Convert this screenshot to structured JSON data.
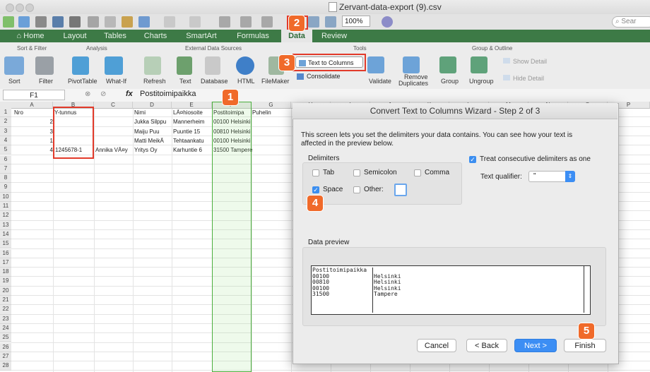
{
  "window": {
    "title": "Zervant-data-export (9).csv"
  },
  "toolbar": {
    "zoom": "100%",
    "search_placeholder": "Sear"
  },
  "tabs": [
    "Home",
    "Layout",
    "Tables",
    "Charts",
    "SmartArt",
    "Formulas",
    "Data",
    "Review"
  ],
  "ribbon": {
    "groups": [
      "Sort & Filter",
      "Analysis",
      "External Data Sources",
      "Tools",
      "Group & Outline"
    ],
    "items": {
      "sort": "Sort",
      "filter": "Filter",
      "pivottable": "PivotTable",
      "whatif": "What-If",
      "refresh": "Refresh",
      "text": "Text",
      "database": "Database",
      "html": "HTML",
      "filemaker": "FileMaker",
      "text_to_columns": "Text to Columns",
      "consolidate": "Consolidate",
      "validate": "Validate",
      "remove_dup_1": "Remove",
      "remove_dup_2": "Duplicates",
      "group": "Group",
      "ungroup": "Ungroup",
      "show_detail": "Show Detail",
      "hide_detail": "Hide Detail"
    }
  },
  "formula_bar": {
    "name_box": "F1",
    "fx": "fx",
    "formula": "Postitoimipaikka"
  },
  "sheet": {
    "columns": [
      "A",
      "B",
      "C",
      "D",
      "E",
      "F",
      "G",
      "H",
      "I",
      "J",
      "K",
      "L",
      "M",
      "N",
      "O",
      "P"
    ],
    "rows": [
      "1",
      "2",
      "3",
      "4",
      "5",
      "6",
      "7",
      "8",
      "9",
      "10",
      "11",
      "12",
      "13",
      "14",
      "15",
      "16",
      "17",
      "18",
      "19",
      "20",
      "21",
      "22",
      "23",
      "24",
      "25",
      "26",
      "27",
      "28"
    ],
    "cells": {
      "a1": "Nro",
      "b1": "Y-tunnus",
      "d1": "Nimi",
      "e1": "LÃ¤hiosoite",
      "f1": "Postitoimipa",
      "g1": "Puhelin",
      "a2": "2",
      "d2": "Jukka Silppu",
      "e2": "Mannerheim",
      "f2": "00100 Helsinki",
      "a3": "3",
      "d3": "Maiju Puu",
      "e3": "Puuntie 15",
      "f3": "00810 Helsinki",
      "a4": "1",
      "d4": "Matti MeikÃ",
      "e4": "Tehtaankatu",
      "f4": "00100 Helsinki",
      "a5": "4",
      "b5": "1245678-1",
      "c5": "Annika VÃ¤y",
      "d5": "Yritys Oy",
      "e5": "Karhuntie 6",
      "f5": "31500 Tampere"
    }
  },
  "badges": [
    "1",
    "2",
    "3",
    "4",
    "5"
  ],
  "dialog": {
    "title": "Convert Text to Columns Wizard - Step 2 of 3",
    "intro": "This screen lets you set the delimiters your data contains.  You can see how your text is affected in the preview below.",
    "delimiters_label": "Delimiters",
    "tab": "Tab",
    "semicolon": "Semicolon",
    "comma": "Comma",
    "space": "Space",
    "other": "Other:",
    "consecutive": "Treat consecutive delimiters as one",
    "qualifier_label": "Text qualifier:",
    "qualifier_value": "\"",
    "preview_label": "Data preview",
    "preview_col1": [
      "Postitoimipaikka",
      "00100",
      "00810",
      "00100",
      "31500"
    ],
    "preview_col2": [
      "",
      "Helsinki",
      "Helsinki",
      "Helsinki",
      "Tampere"
    ],
    "buttons": {
      "cancel": "Cancel",
      "back": "< Back",
      "next": "Next >",
      "finish": "Finish"
    },
    "checked": {
      "tab": false,
      "semicolon": false,
      "comma": false,
      "space": true,
      "other": false,
      "consecutive": true
    }
  },
  "colors": {
    "ribbon_green": "#3d7a46",
    "badge_orange": "#f06a2a",
    "highlight_red": "#e23a2a",
    "button_blue": "#3c8ef4"
  }
}
